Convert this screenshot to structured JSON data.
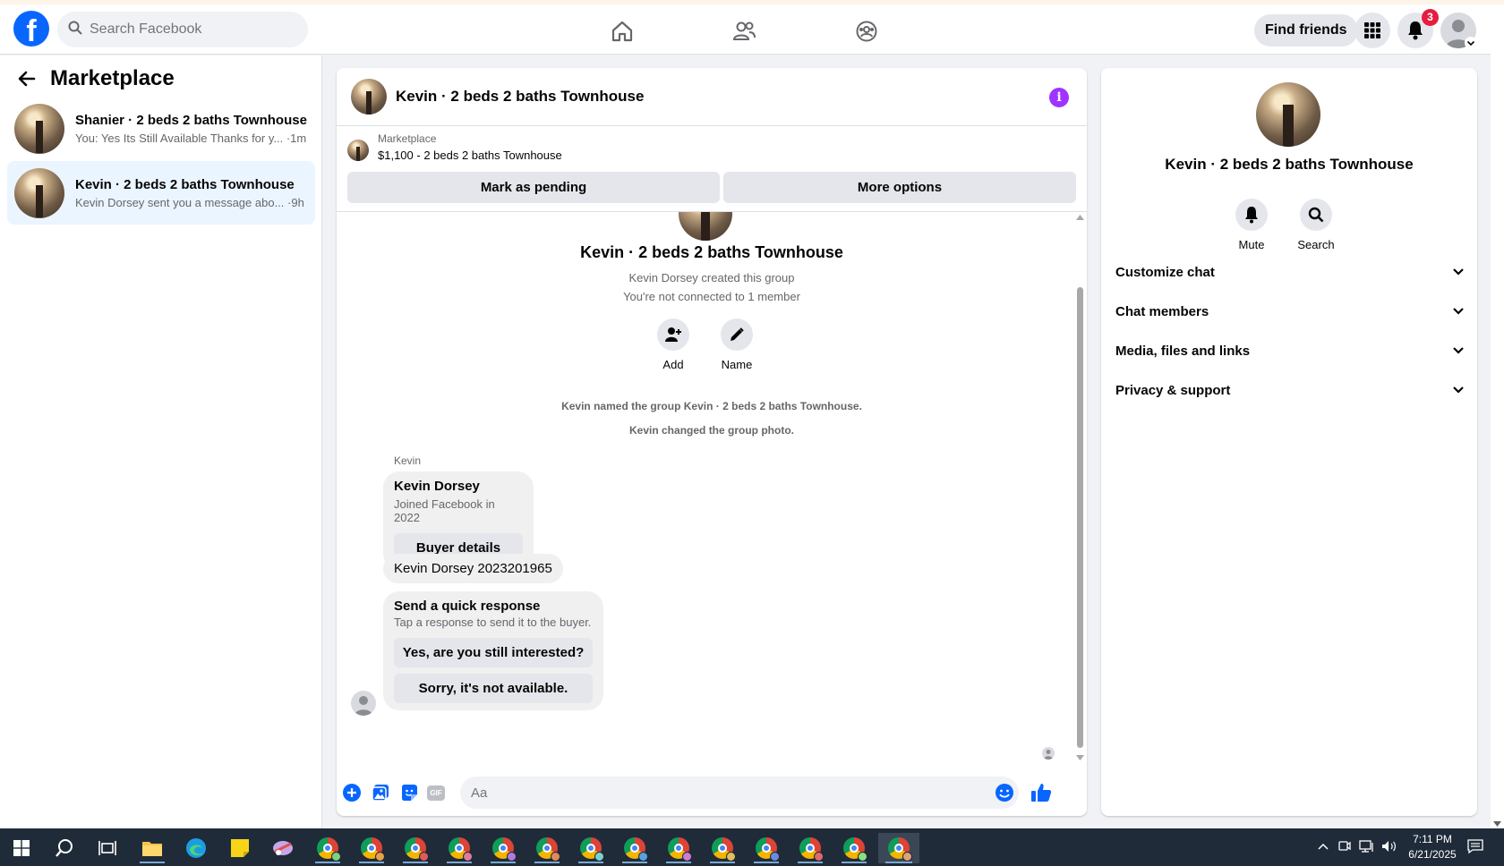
{
  "topbar": {
    "search_placeholder": "Search Facebook",
    "logo_letter": "f",
    "find_friends_label": "Find friends",
    "notification_count": "3"
  },
  "sidebar": {
    "title": "Marketplace",
    "conversations": [
      {
        "title": "Shanier · 2 beds 2 baths Townhouse",
        "preview": "You: Yes Its Still Available Thanks for y... ·1m"
      },
      {
        "title": "Kevin · 2 beds 2 baths Townhouse",
        "preview": "Kevin Dorsey sent you a message abo... ·9h"
      }
    ]
  },
  "chat": {
    "title": "Kevin · 2 beds 2 baths Townhouse",
    "listing_label": "Marketplace",
    "listing_price": "$1,100 - 2 beds 2 baths Townhouse",
    "mark_pending_label": "Mark as pending",
    "more_options_label": "More options",
    "group_name": "Kevin · 2 beds 2 baths Townhouse",
    "created_by": "Kevin Dorsey created this group",
    "not_connected": "You're not connected to 1 member",
    "add_label": "Add",
    "name_label": "Name",
    "system_messages": [
      "Kevin named the group Kevin · 2 beds 2 baths Townhouse.",
      "Kevin changed the group photo."
    ],
    "sender_name": "Kevin",
    "buyer_card": {
      "name": "Kevin Dorsey",
      "joined": "Joined Facebook in 2022",
      "button": "Buyer details"
    },
    "message_phone": "Kevin Dorsey 2023201965",
    "quick_response": {
      "title": "Send a quick response",
      "subtitle": "Tap a response to send it to the buyer.",
      "options": [
        "Yes, are you still interested?",
        "Sorry, it's not available."
      ]
    },
    "composer_placeholder": "Aa",
    "gif_label": "GIF"
  },
  "details": {
    "name": "Kevin · 2 beds 2 baths Townhouse",
    "mute_label": "Mute",
    "search_label": "Search",
    "sections": [
      "Customize chat",
      "Chat members",
      "Media, files and links",
      "Privacy & support"
    ]
  },
  "taskbar": {
    "time": "7:11 PM",
    "date": "6/21/2025"
  },
  "colors": {
    "brand_blue": "#0866ff",
    "info_purple": "#a033ff",
    "badge_red": "#e41e3f"
  }
}
